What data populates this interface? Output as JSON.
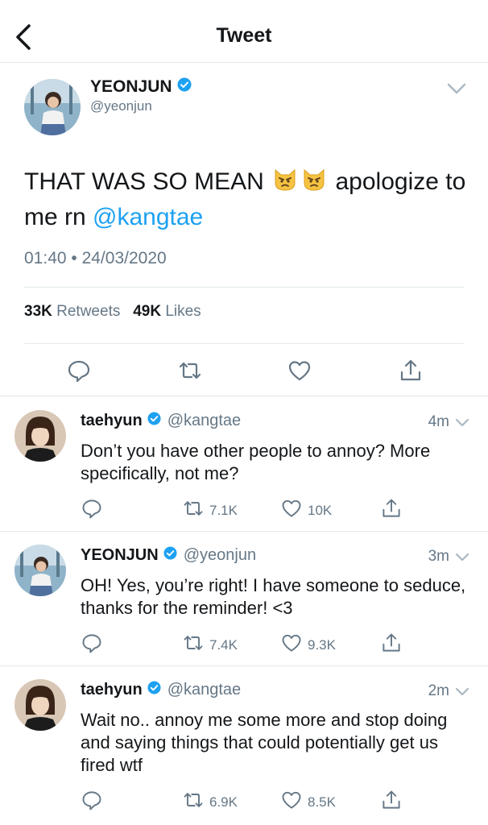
{
  "header": {
    "title": "Tweet"
  },
  "main_tweet": {
    "name": "YEONJUN",
    "handle": "@yeonjun",
    "text_before": "THAT WAS SO MEAN",
    "emoji": [
      "pouting-cat-emoji",
      "pouting-cat-emoji"
    ],
    "text_after": "apologize to me rn",
    "mention": "@kangtae",
    "timestamp": "01:40 • 24/03/2020",
    "retweets_count": "33K",
    "retweets_label": "Retweets",
    "likes_count": "49K",
    "likes_label": "Likes"
  },
  "replies": [
    {
      "name": "taehyun",
      "handle": "@kangtae",
      "time": "4m",
      "text": "Don’t you have other people to annoy? More specifically, not me?",
      "retweets": "7.1K",
      "likes": "10K"
    },
    {
      "name": "YEONJUN",
      "handle": "@yeonjun",
      "time": "3m",
      "text": "OH! Yes, you’re right! I have someone to seduce, thanks for the reminder! <3",
      "retweets": "7.4K",
      "likes": "9.3K"
    },
    {
      "name": "taehyun",
      "handle": "@kangtae",
      "time": "2m",
      "text": "Wait no.. annoy me some more and stop doing and saying things that could potentially get us fired wtf",
      "retweets": "6.9K",
      "likes": "8.5K"
    }
  ],
  "colors": {
    "accent": "#1da1f2",
    "secondary_text": "#657786",
    "divider": "#e1e8ed",
    "emoji_fill": "#f5c242"
  },
  "icons": [
    "back-arrow-icon",
    "chevron-down-icon",
    "verified-badge-icon",
    "reply-icon",
    "retweet-icon",
    "like-icon",
    "share-icon"
  ]
}
